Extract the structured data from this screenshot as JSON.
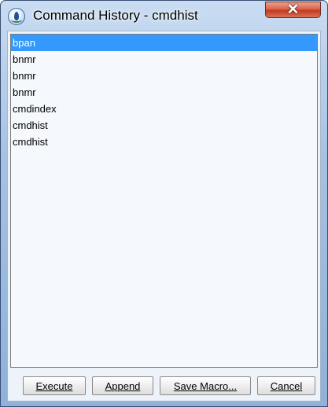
{
  "window": {
    "title": "Command History - cmdhist",
    "close_symbol": "✕"
  },
  "history": {
    "items": [
      "bpan",
      "bnmr",
      "bnmr",
      "bnmr",
      "cmdindex",
      "cmdhist",
      "cmdhist"
    ],
    "selected_index": 0
  },
  "buttons": {
    "execute": "Execute",
    "append": "Append",
    "save_macro": "Save Macro...",
    "cancel": "Cancel"
  },
  "colors": {
    "selection": "#3399ff",
    "list_background": "#f5f8fc",
    "close_button": "#c23a1f"
  }
}
